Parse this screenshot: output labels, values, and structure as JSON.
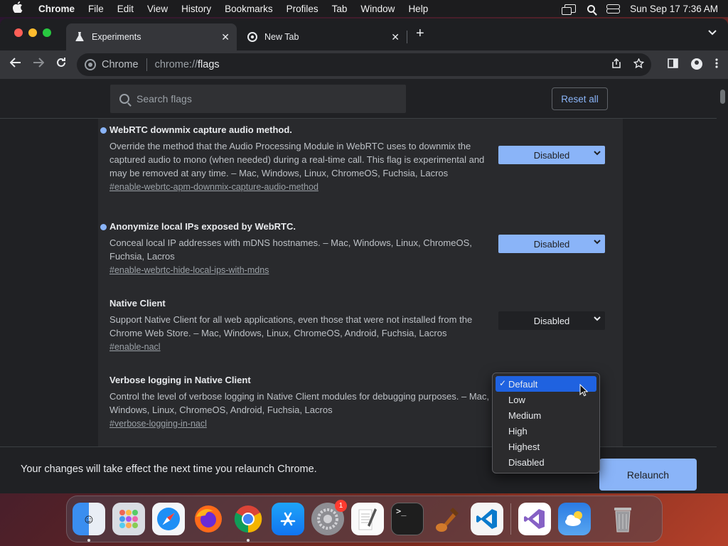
{
  "menubar": {
    "app_name": "Chrome",
    "items": [
      "File",
      "Edit",
      "View",
      "History",
      "Bookmarks",
      "Profiles",
      "Tab",
      "Window",
      "Help"
    ],
    "clock": "Sun Sep 17  7:36 AM"
  },
  "tabs": [
    {
      "title": "Experiments",
      "icon": "flask-icon",
      "active": true
    },
    {
      "title": "New Tab",
      "icon": "chrome-icon",
      "active": false
    }
  ],
  "omnibox": {
    "site_label": "Chrome",
    "url_scheme": "chrome://",
    "url_host": "flags"
  },
  "flags_page": {
    "search_placeholder": "Search flags",
    "reset_all_label": "Reset all",
    "experiments": [
      {
        "title": "WebRTC downmix capture audio method.",
        "description": "Override the method that the Audio Processing Module in WebRTC uses to downmix the captured audio to mono (when needed) during a real-time call. This flag is experimental and may be removed at any time. – Mac, Windows, Linux, ChromeOS, Fuchsia, Lacros",
        "link": "#enable-webrtc-apm-downmix-capture-audio-method",
        "value": "Disabled",
        "modified": true
      },
      {
        "title": "Anonymize local IPs exposed by WebRTC.",
        "description": "Conceal local IP addresses with mDNS hostnames. – Mac, Windows, Linux, ChromeOS, Fuchsia, Lacros",
        "link": "#enable-webrtc-hide-local-ips-with-mdns",
        "value": "Disabled",
        "modified": true
      },
      {
        "title": "Native Client",
        "description": "Support Native Client for all web applications, even those that were not installed from the Chrome Web Store. – Mac, Windows, Linux, ChromeOS, Android, Fuchsia, Lacros",
        "link": "#enable-nacl",
        "value": "Disabled",
        "modified": false
      },
      {
        "title": "Verbose logging in Native Client",
        "description": "Control the level of verbose logging in Native Client modules for debugging purposes. – Mac, Windows, Linux, ChromeOS, Android, Fuchsia, Lacros",
        "link": "#verbose-logging-in-nacl",
        "value": "Default",
        "modified": false
      }
    ],
    "dropdown_options": [
      "Default",
      "Low",
      "Medium",
      "High",
      "Highest",
      "Disabled"
    ],
    "dropdown_selected": "Default",
    "footer_message": "Your changes will take effect the next time you relaunch Chrome.",
    "relaunch_label": "Relaunch"
  },
  "dock": {
    "apps": [
      "Finder",
      "Launchpad",
      "Safari",
      "Firefox",
      "Chrome",
      "App Store",
      "System Settings",
      "TextEdit",
      "Terminal",
      "Instruments",
      "Visual Studio Code",
      "Visual Studio",
      "Weather",
      "Trash"
    ],
    "settings_badge": "1"
  },
  "colors": {
    "accent": "#8ab4f8",
    "selection": "#1f62e0",
    "page_bg": "#202124"
  }
}
